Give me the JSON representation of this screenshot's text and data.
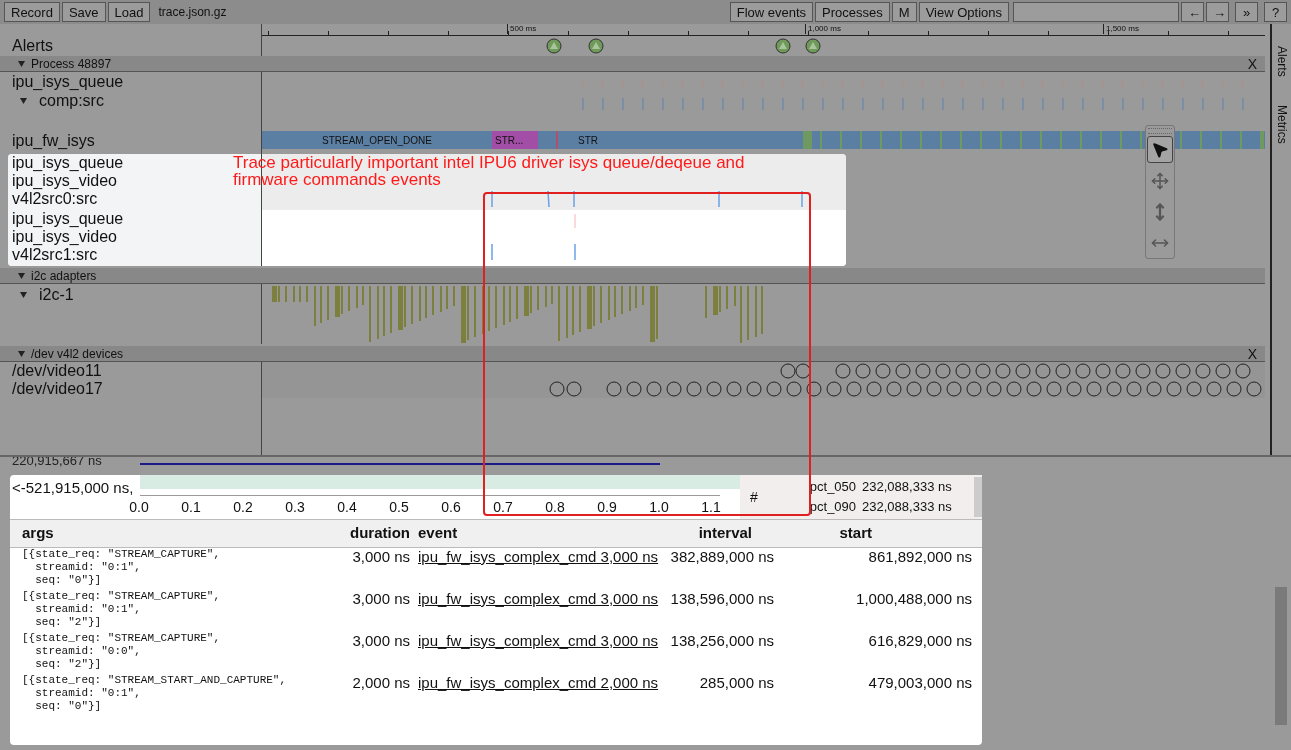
{
  "toolbar": {
    "left_buttons": [
      "Record",
      "Save",
      "Load"
    ],
    "filename": "trace.json.gz",
    "right_buttons": [
      "Flow events",
      "Processes",
      "M",
      "View Options"
    ],
    "nav_buttons": [
      "←",
      "→"
    ],
    "more_button": "»",
    "help_button": "?"
  },
  "ruler": {
    "labels": [
      "500 ms",
      "1,000 ms",
      "1,500 ms"
    ]
  },
  "alerts": {
    "label": "Alerts"
  },
  "groups": [
    {
      "title": "Process 48897",
      "expanded": true,
      "close": "X",
      "tracks": [
        {
          "kind": "ticks",
          "labels": [
            "ipu_isys_queue"
          ],
          "child": "comp:src",
          "expanded": true
        },
        {
          "kind": "slices",
          "labels": [
            "ipu_fw_isys"
          ],
          "slices": [
            {
              "label": "STREAM_OPEN_DONE",
              "color": "#5b7fa3"
            },
            {
              "label": "STR...",
              "color": "#a24ea6"
            },
            {
              "label": "STR",
              "color": "#5b7fa3"
            }
          ]
        },
        {
          "kind": "spotlight",
          "labels": [
            "ipu_isys_queue",
            "ipu_isys_video",
            "v4l2src0:src"
          ]
        },
        {
          "kind": "spotlight",
          "labels": [
            "ipu_isys_queue",
            "ipu_isys_video",
            "v4l2src1:src"
          ]
        }
      ]
    },
    {
      "title": "i2c adapters",
      "expanded": true,
      "tracks": [
        {
          "kind": "bars",
          "child": "i2c-1",
          "expanded": true
        }
      ]
    },
    {
      "title": "/dev v4l2 devices",
      "expanded": true,
      "close": "X",
      "tracks": [
        {
          "kind": "circles",
          "labels": [
            "/dev/video11"
          ]
        },
        {
          "kind": "circles",
          "labels": [
            "/dev/video17"
          ]
        }
      ]
    }
  ],
  "annotation": "Trace particularly important intel IPU6 driver isys queue/deqeue and firmware commands events",
  "mouse_modes": [
    {
      "kind": "select",
      "selected": true
    },
    {
      "kind": "pan",
      "selected": false
    },
    {
      "kind": "zoom",
      "selected": false
    },
    {
      "kind": "timing",
      "selected": false
    }
  ],
  "side_tabs": [
    "Alerts",
    "Metrics"
  ],
  "histogram": {
    "top_label": "220,915,667 ns",
    "min_label": "<-521,915,000 ns,",
    "axis_labels": [
      "0.0",
      "0.1",
      "0.2",
      "0.3",
      "0.4",
      "0.5",
      "0.6",
      "0.7",
      "0.8",
      "0.9",
      "1.0",
      "1.1"
    ],
    "count_header": "#",
    "stats": [
      {
        "name": "pct_050",
        "value": "232,088,333 ns"
      },
      {
        "name": "pct_090",
        "value": "232,088,333 ns"
      }
    ]
  },
  "table": {
    "columns": [
      "args",
      "duration",
      "event",
      "interval",
      "start"
    ],
    "rows": [
      {
        "args": "[{state_req: \"STREAM_CAPTURE\",\n  streamid: \"0:1\",\n  seq: \"0\"}]",
        "duration": "3,000 ns",
        "event": "ipu_fw_isys_complex_cmd 3,000 ns",
        "interval": "382,889,000 ns",
        "start": "861,892,000 ns"
      },
      {
        "args": "[{state_req: \"STREAM_CAPTURE\",\n  streamid: \"0:1\",\n  seq: \"2\"}]",
        "duration": "3,000 ns",
        "event": "ipu_fw_isys_complex_cmd 3,000 ns",
        "interval": "138,596,000 ns",
        "start": "1,000,488,000 ns"
      },
      {
        "args": "[{state_req: \"STREAM_CAPTURE\",\n  streamid: \"0:0\",\n  seq: \"2\"}]",
        "duration": "3,000 ns",
        "event": "ipu_fw_isys_complex_cmd 3,000 ns",
        "interval": "138,256,000 ns",
        "start": "616,829,000 ns"
      },
      {
        "args": "[{state_req: \"STREAM_START_AND_CAPTURE\",\n  streamid: \"0:1\",\n  seq: \"0\"}]",
        "duration": "2,000 ns",
        "event": "ipu_fw_isys_complex_cmd 2,000 ns",
        "interval": "285,000 ns",
        "start": "479,003,000 ns"
      }
    ]
  }
}
